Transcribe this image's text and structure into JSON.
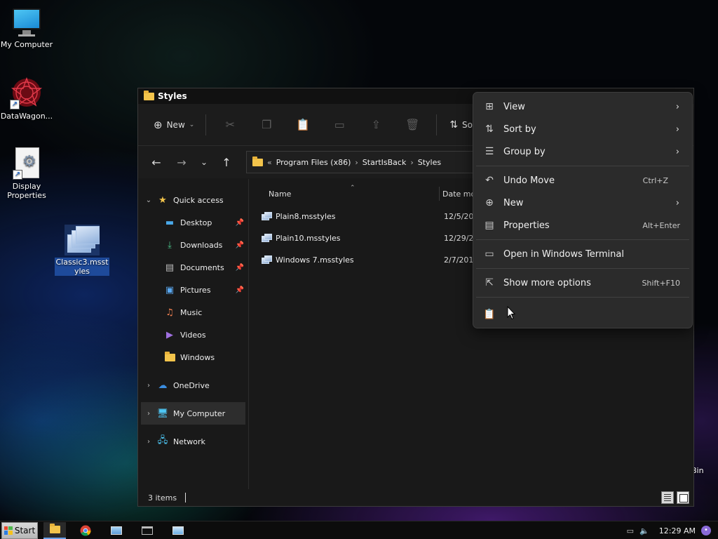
{
  "desktop": {
    "icons": [
      {
        "label": "My Computer"
      },
      {
        "label": "DataWagon..."
      },
      {
        "label": "Display Properties"
      },
      {
        "label": "Classic3.msstyles"
      }
    ],
    "partial_label": "Bin"
  },
  "window": {
    "title": "Styles",
    "toolbar": {
      "new_label": "New",
      "sort_label": "Sort"
    },
    "address": {
      "overflow": "«",
      "crumbs": [
        "Program Files (x86)",
        "StartIsBack",
        "Styles"
      ]
    },
    "sidebar": {
      "items": [
        {
          "label": "Quick access",
          "icon": "star-icon"
        },
        {
          "label": "Desktop",
          "icon": "desktop-icon"
        },
        {
          "label": "Downloads",
          "icon": "download-icon"
        },
        {
          "label": "Documents",
          "icon": "document-icon"
        },
        {
          "label": "Pictures",
          "icon": "pictures-icon"
        },
        {
          "label": "Music",
          "icon": "music-icon"
        },
        {
          "label": "Videos",
          "icon": "videos-icon"
        },
        {
          "label": "Windows",
          "icon": "folder-icon"
        },
        {
          "label": "OneDrive",
          "icon": "cloud-icon"
        },
        {
          "label": "My Computer",
          "icon": "computer-icon"
        },
        {
          "label": "Network",
          "icon": "network-icon"
        }
      ]
    },
    "columns": {
      "name": "Name",
      "date": "Date mo"
    },
    "files": [
      {
        "name": "Plain8.msstyles",
        "date": "12/5/20"
      },
      {
        "name": "Plain10.msstyles",
        "date": "12/29/20"
      },
      {
        "name": "Windows 7.msstyles",
        "date": "2/7/2019"
      }
    ],
    "status": {
      "count": "3 items"
    }
  },
  "context_menu": {
    "items": [
      {
        "label": "View",
        "icon": "view-grid-icon",
        "submenu": true
      },
      {
        "label": "Sort by",
        "icon": "sort-icon",
        "submenu": true
      },
      {
        "label": "Group by",
        "icon": "group-icon",
        "submenu": true
      },
      {
        "label": "Undo Move",
        "icon": "undo-icon",
        "shortcut": "Ctrl+Z"
      },
      {
        "label": "New",
        "icon": "plus-circle-icon",
        "submenu": true
      },
      {
        "label": "Properties",
        "icon": "properties-icon",
        "shortcut": "Alt+Enter"
      },
      {
        "label": "Open in Windows Terminal",
        "icon": "terminal-icon"
      },
      {
        "label": "Show more options",
        "icon": "share-icon",
        "shortcut": "Shift+F10"
      }
    ]
  },
  "taskbar": {
    "start_label": "Start",
    "clock": "12:29 AM",
    "apps": [
      "file-explorer-icon",
      "chrome-icon",
      "image-viewer-icon",
      "terminal-icon",
      "control-panel-icon"
    ]
  },
  "colors": {
    "window_bg": "#191919",
    "menu_bg": "#2b2b2b",
    "accent": "#1e4a9a",
    "folder": "#f3c44b"
  }
}
